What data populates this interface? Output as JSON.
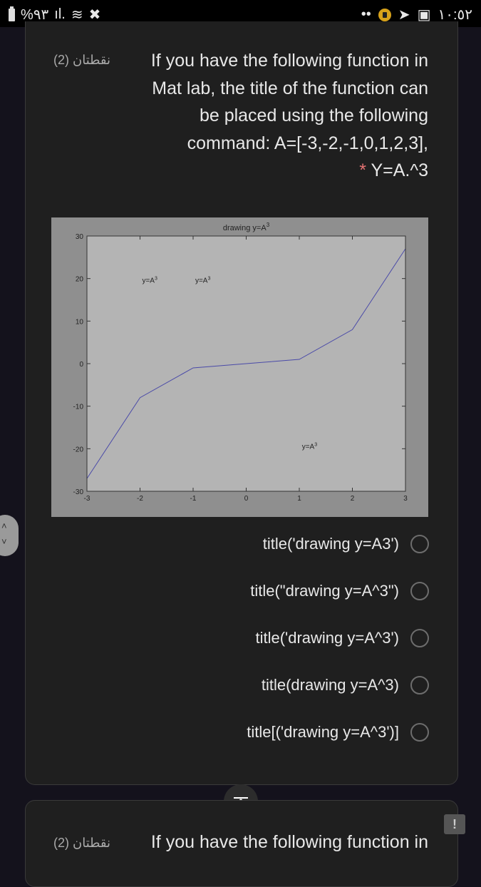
{
  "status_bar": {
    "battery": "%٩٣",
    "signal_icon": "signal-bars-icon",
    "wifi_icon": "wifi-icon",
    "mute_icon": "mute-icon",
    "dots": "••",
    "notification_icons": [
      "app-badge-icon",
      "telegram-icon",
      "gallery-icon"
    ],
    "time": "١٠:٥٢"
  },
  "question1": {
    "points": "نقطتان (2)",
    "lines": [
      "If you have the following function in",
      "Mat lab, the title of the function can",
      "be placed using the following",
      "command: A=[-3,-2,-1,0,1,2,3],"
    ],
    "required_marker": "*",
    "last_line": "Y=A.^3",
    "options": [
      {
        "label": "title('drawing y=A3')",
        "selected": false
      },
      {
        "label": "title(\"drawing y=A^3\")",
        "selected": false
      },
      {
        "label": "title('drawing y=A^3')",
        "selected": false
      },
      {
        "label": "title(drawing y=A^3)",
        "selected": false
      },
      {
        "label": "title[('drawing y=A^3')]",
        "selected": false
      }
    ]
  },
  "question2": {
    "points": "نقطتان (2)",
    "first_line": "If you have the following function in"
  },
  "nav": {
    "up": "˄",
    "down": "˅",
    "scroll_top": "˄",
    "feedback": "!"
  },
  "chart_data": {
    "type": "line",
    "title": "drawing y=A",
    "title_superscript": "3",
    "x": [
      -3,
      -2,
      -1,
      0,
      1,
      2,
      3
    ],
    "series": [
      {
        "name": "y=A^3",
        "values": [
          -27,
          -8,
          -1,
          0,
          1,
          8,
          27
        ],
        "color": "#4a4aa8"
      }
    ],
    "xlim": [
      -3,
      3
    ],
    "ylim": [
      -30,
      30
    ],
    "xticks": [
      "-3",
      "-2",
      "-1",
      "0",
      "1",
      "2",
      "3"
    ],
    "yticks": [
      "30",
      "20",
      "10",
      "0",
      "-10",
      "-20",
      "-30"
    ],
    "xlabel": "",
    "ylabel": "",
    "grid": false,
    "annotations": [
      {
        "text": "y=A",
        "sup": "3",
        "x": -1.96,
        "y": 19
      },
      {
        "text": "y=A",
        "sup": "3",
        "x": -0.96,
        "y": 19
      },
      {
        "text": "y=A",
        "sup": "3",
        "x": 1.05,
        "y": -20
      }
    ],
    "background": "#b4b4b4",
    "figure_background": "#8f8f8f"
  }
}
